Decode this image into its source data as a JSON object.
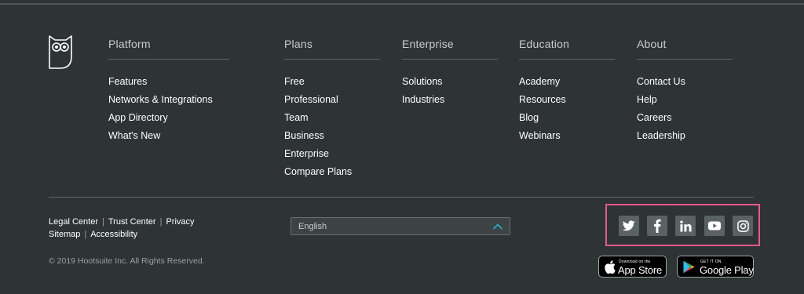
{
  "logo": {
    "icon": "hootsuite-owl-icon"
  },
  "columns": [
    {
      "title": "Platform",
      "links": [
        "Features",
        "Networks & Integrations",
        "App Directory",
        "What's New"
      ]
    },
    {
      "title": "Plans",
      "links": [
        "Free",
        "Professional",
        "Team",
        "Business",
        "Enterprise",
        "Compare Plans"
      ]
    },
    {
      "title": "Enterprise",
      "links": [
        "Solutions",
        "Industries"
      ]
    },
    {
      "title": "Education",
      "links": [
        "Academy",
        "Resources",
        "Blog",
        "Webinars"
      ]
    },
    {
      "title": "About",
      "links": [
        "Contact Us",
        "Help",
        "Careers",
        "Leadership"
      ]
    }
  ],
  "legal": {
    "legal_center": "Legal Center",
    "trust_center": "Trust Center",
    "privacy": "Privacy",
    "sitemap": "Sitemap",
    "accessibility": "Accessibility",
    "separator": "|"
  },
  "copyright": "© 2019 Hootsuite Inc. All Rights Reserved.",
  "language": {
    "selected": "English",
    "icon": "chevron-up-icon"
  },
  "social": [
    "twitter-icon",
    "facebook-icon",
    "linkedin-icon",
    "youtube-icon",
    "instagram-icon"
  ],
  "app_store": {
    "small": "Download on the",
    "big": "App Store"
  },
  "google_play": {
    "small": "GET IT ON",
    "big": "Google Play"
  },
  "colors": {
    "background": "#2e3334",
    "highlight_border": "#e8578e",
    "caret": "#27b0d6",
    "social_tile": "#5b6264"
  }
}
